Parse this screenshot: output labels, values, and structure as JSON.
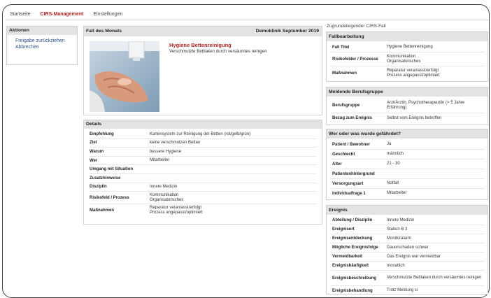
{
  "nav": {
    "items": [
      "Startseite",
      "CIRS-Management",
      "Einstellungen"
    ],
    "active": "CIRS-Management"
  },
  "right_label": "Zugrundeliegender CIRS-Fall",
  "actions": {
    "title": "Aktionen",
    "items": [
      "Freigabe zurückziehen",
      "Abbrechen"
    ]
  },
  "fall_des_monats": {
    "title": "Fall des Monats",
    "meta": "Demoklinik September 2019",
    "headline": "Hygiene Bettenreinigung",
    "description": "Verschmutzte Bettlaken durch versäumtes reinigen",
    "image_icon": "hand-disinfection-photo"
  },
  "details": {
    "title": "Details",
    "rows": [
      {
        "k": "Empfehlung",
        "v": "Kartensystem zur Reinigung der Betten (rot/gelb/grün)"
      },
      {
        "k": "Ziel",
        "v": "keine verschmutzen Betten"
      },
      {
        "k": "Warum",
        "v": "bessere Hygiene"
      },
      {
        "k": "Wer",
        "v": "Mitarbeiter"
      },
      {
        "k": "Umgang mit Situation",
        "v": ""
      },
      {
        "k": "Zusatzhinweise",
        "v": ""
      },
      {
        "k": "Disziplin",
        "v": "Innere Medizin"
      },
      {
        "k": "Risikofeld / Prozess",
        "v": "Kommunikation\nOrganisatorisches"
      },
      {
        "k": "Maßnahmen",
        "v": "Reparatur veranlasst/erfolgt\nProzess angepasst/optimiert"
      }
    ]
  },
  "fallbearbeitung": {
    "title": "Fallbearbeitung",
    "rows": [
      {
        "k": "Fall Titel",
        "v": "Hygiene Bettenreinigung"
      },
      {
        "k": "Risikofelder / Prozesse",
        "v": "Kommunikation\nOrganisatorisches"
      },
      {
        "k": "Maßnahmen",
        "v": "Reparatur veranlasst/erfolgt\nProzess angepasst/optimiert"
      }
    ]
  },
  "meldende": {
    "title": "Meldende Berufsgruppe",
    "rows": [
      {
        "k": "Berufsgruppe",
        "v": "Arzt/Ärztin, Psychotherapeut/in (> 5 Jahre Erfahrung)"
      },
      {
        "k": "Bezug zum Ereignis",
        "v": "Selbst vom Ereignis betroffen"
      }
    ]
  },
  "wer_oder_was": {
    "title": "Wer oder was wurde gefährdet?",
    "rows": [
      {
        "k": "Patient / Bewohner",
        "v": "Ja"
      },
      {
        "k": "Geschlecht",
        "v": "männlich"
      },
      {
        "k": "Alter",
        "v": "21 - 30"
      },
      {
        "k": "Patientenhintergrund",
        "v": ""
      },
      {
        "k": "Versorgungsart",
        "v": "Notfall"
      },
      {
        "k": "Individualfrage 1",
        "v": "Mitarbeiter"
      }
    ]
  },
  "ereignis": {
    "title": "Ereignis",
    "rows": [
      {
        "k": "Abteilung / Disziplin",
        "v": "Innere Medizin"
      },
      {
        "k": "Ereignisort",
        "v": "Station B 3"
      },
      {
        "k": "Ereignisentdeckung",
        "v": "Monitoralarm"
      },
      {
        "k": "Mögliche Ereignisfolge",
        "v": "Dauerschaden schwer"
      },
      {
        "k": "Vermeidbarkeit",
        "v": "Das Ereignis war vermeidbar"
      },
      {
        "k": "Ereignishäufigkeit",
        "v": "monatlich"
      },
      {
        "k": "Ereignisbeschreibung",
        "v": "Verschmutzte Bettlaken durch versäumtes reinigen"
      },
      {
        "k": "Ereignisbehandlung",
        "v": "Trotz Meldung si"
      }
    ]
  },
  "colors": {
    "accent": "#b32222",
    "link": "#2a4d8a",
    "header_bg": "#e3e3e3"
  }
}
